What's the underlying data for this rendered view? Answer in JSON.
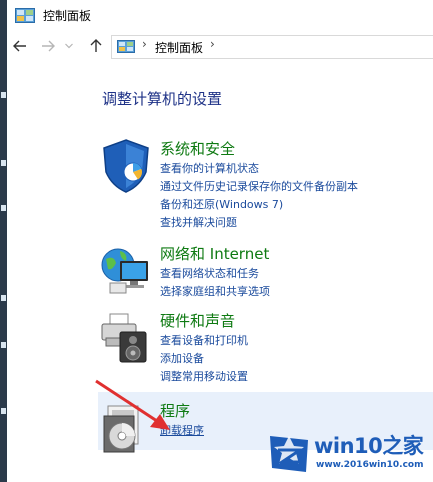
{
  "window": {
    "title": "控制面板",
    "icon": "control-panel-icon"
  },
  "nav": {
    "back_icon": "arrow-left-icon",
    "forward_icon": "arrow-right-icon",
    "dropdown_icon": "chevron-down-icon",
    "up_icon": "arrow-up-icon",
    "breadcrumb": [
      "控制面板"
    ],
    "separator": "›"
  },
  "main": {
    "heading": "调整计算机的设置",
    "categories": [
      {
        "title": "系统和安全",
        "icon": "shield-icon",
        "links": [
          "查看你的计算机状态",
          "通过文件历史记录保存你的文件备份副本",
          "备份和还原(Windows 7)",
          "查找并解决问题"
        ]
      },
      {
        "title": "网络和 Internet",
        "icon": "network-globe-icon",
        "links": [
          "查看网络状态和任务",
          "选择家庭组和共享选项"
        ]
      },
      {
        "title": "硬件和声音",
        "icon": "printer-speaker-icon",
        "links": [
          "查看设备和打印机",
          "添加设备",
          "调整常用移动设置"
        ]
      },
      {
        "title": "程序",
        "icon": "programs-disc-icon",
        "links": [
          "卸载程序"
        ]
      }
    ]
  },
  "overlay": {
    "annotation": "red-arrow-icon"
  },
  "watermark": {
    "title": "win10之家",
    "url": "www.2016win10.com",
    "logo": "win10-logo-icon"
  },
  "colors": {
    "heading": "#1e3287",
    "category_title": "#0e7a12",
    "link": "#1a4a9c",
    "highlight": "#e8f0fb",
    "arrow": "#e03030",
    "watermark": "#1e5db8"
  }
}
